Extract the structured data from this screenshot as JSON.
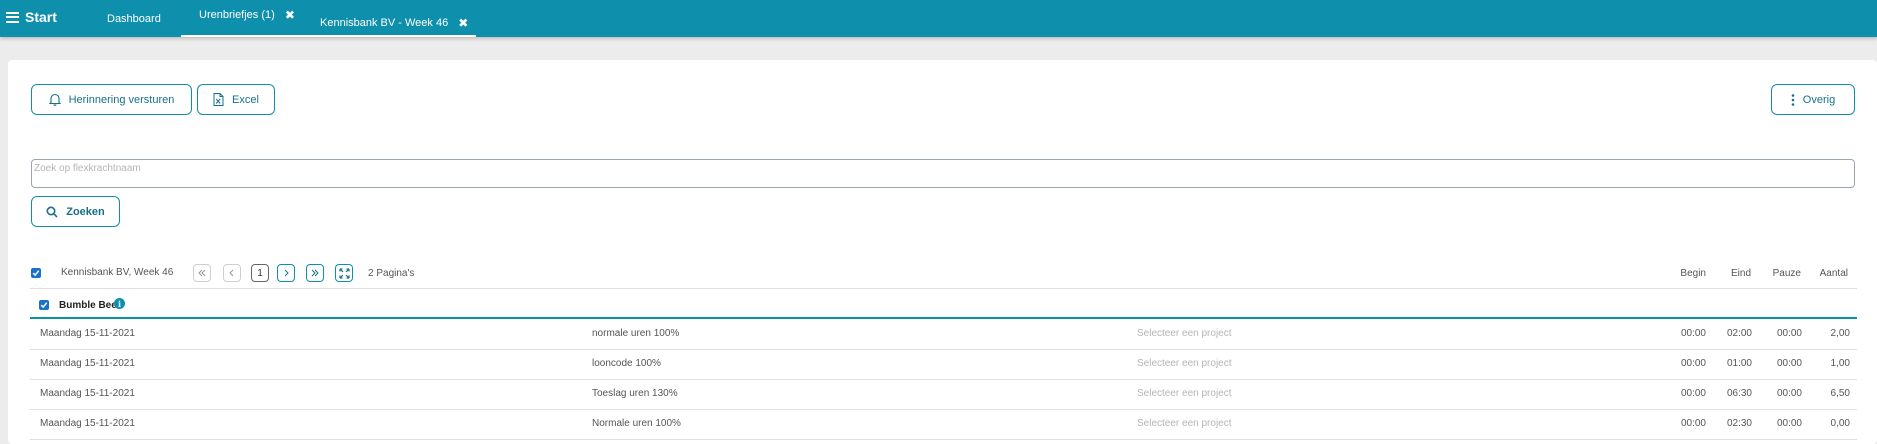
{
  "topbar": {
    "menu_label": "Start",
    "tabs": [
      {
        "label": "Dashboard"
      },
      {
        "label": "Urenbriefjes (1)",
        "closable": true
      },
      {
        "label": "Kennisbank BV - Week 46",
        "closable": true,
        "active": true
      }
    ]
  },
  "toolbar": {
    "reminder_label": "Herinnering versturen",
    "excel_label": "Excel",
    "more_label": "Overig"
  },
  "search": {
    "placeholder": "Zoek op flexkrachtnaam",
    "value": "",
    "button_label": "Zoeken"
  },
  "list_header": {
    "title": "Kennisbank BV, Week 46",
    "current_page": "1",
    "pages_label": "2 Pagina's",
    "columns": {
      "begin": "Begin",
      "end": "Eind",
      "pause": "Pauze",
      "amount": "Aantal"
    }
  },
  "group": {
    "name": "Bumble Bee"
  },
  "rows": [
    {
      "date": "Maandag 15-11-2021",
      "code": "normale uren 100%",
      "project": "Selecteer een project",
      "begin": "00:00",
      "end": "02:00",
      "pause": "00:00",
      "amount": "2,00"
    },
    {
      "date": "Maandag 15-11-2021",
      "code": "looncode 100%",
      "project": "Selecteer een project",
      "begin": "00:00",
      "end": "01:00",
      "pause": "00:00",
      "amount": "1,00"
    },
    {
      "date": "Maandag 15-11-2021",
      "code": "Toeslag uren 130%",
      "project": "Selecteer een project",
      "begin": "00:00",
      "end": "06:30",
      "pause": "00:00",
      "amount": "6,50"
    },
    {
      "date": "Maandag 15-11-2021",
      "code": "Normale uren 100%",
      "project": "Selecteer een project",
      "begin": "00:00",
      "end": "02:30",
      "pause": "00:00",
      "amount": "0,00"
    }
  ],
  "colors": {
    "brand": "#0e8fac",
    "checkbox": "#1a73c9"
  }
}
